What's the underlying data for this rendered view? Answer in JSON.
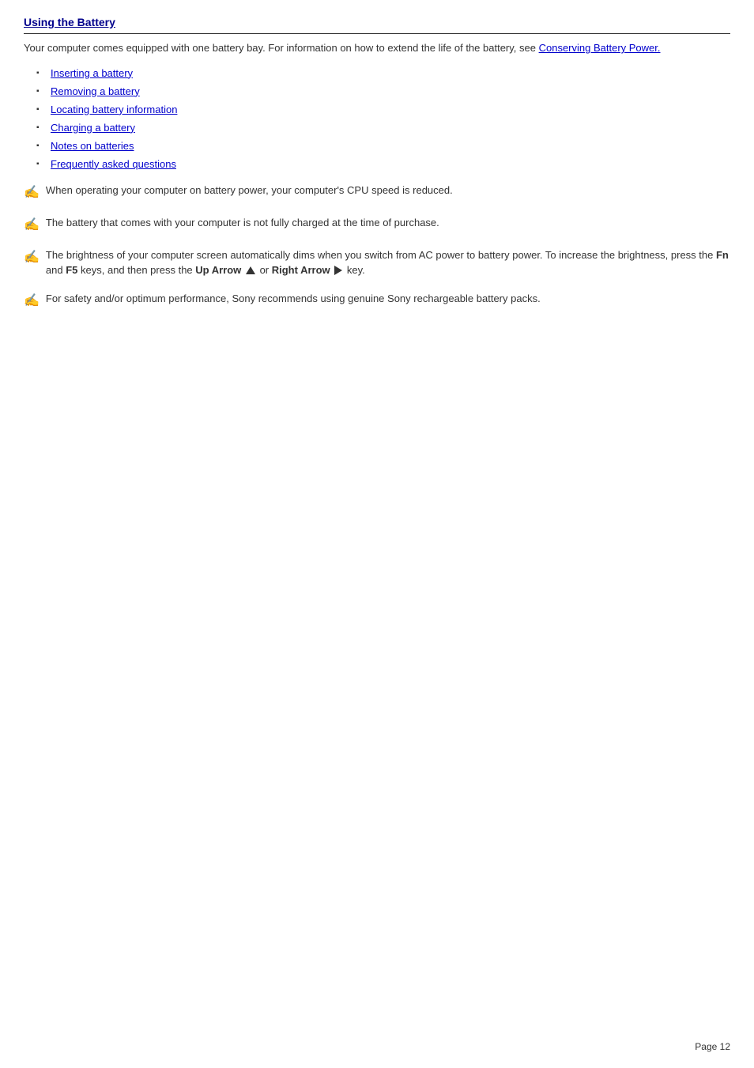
{
  "page": {
    "title": "Using the Battery",
    "page_number_label": "Page 12",
    "intro": {
      "text": "Your computer comes equipped with one battery bay. For information on how to extend the life of the battery, see ",
      "link_text": "Conserving Battery Power."
    },
    "links": [
      {
        "label": "Inserting a battery"
      },
      {
        "label": "Removing a battery"
      },
      {
        "label": "Locating battery information"
      },
      {
        "label": "Charging a battery"
      },
      {
        "label": "Notes on batteries"
      },
      {
        "label": "Frequently asked questions"
      }
    ],
    "notes": [
      {
        "id": "note1",
        "text": "When operating your computer on battery power, your computer's CPU speed is reduced."
      },
      {
        "id": "note2",
        "text": "The battery that comes with your computer is not fully charged at the time of purchase."
      },
      {
        "id": "note3",
        "text_before": "The brightness of your computer screen automatically dims when you switch from AC power to battery power. To increase the brightness, press the ",
        "fn_key": "Fn",
        "text_mid1": " and ",
        "f5_key": "F5",
        "text_mid2": " keys, and then press the ",
        "up_arrow_label": "Up Arrow",
        "text_mid3": " or ",
        "right_arrow_label": "Right Arrow",
        "text_end": " key."
      },
      {
        "id": "note4",
        "text": "For safety and/or optimum performance, Sony recommends using genuine Sony rechargeable battery packs."
      }
    ]
  }
}
